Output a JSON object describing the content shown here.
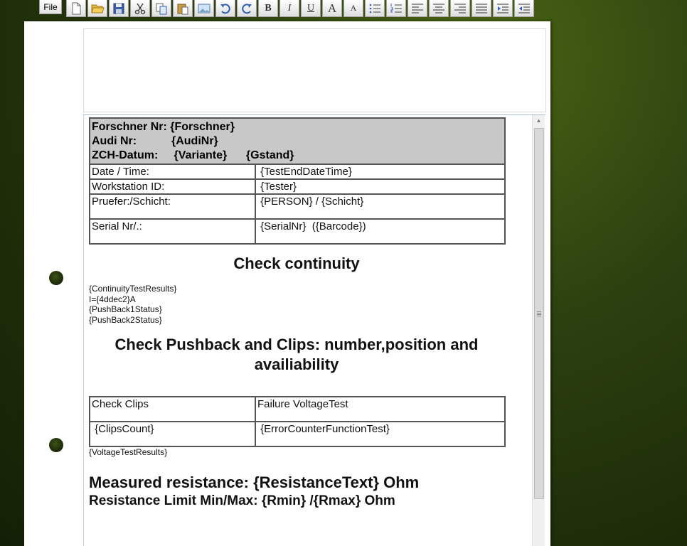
{
  "toolbar": {
    "file_label": "File",
    "bold_label": "B",
    "italic_label": "I",
    "underline_label": "U",
    "grow_font_label": "A",
    "shrink_font_label": "A"
  },
  "document": {
    "header_lines": [
      "Forschner Nr: {Forschner}",
      "Audi Nr:           {AudiNr}",
      "ZCH-Datum:     {Variante}      {Gstand}"
    ],
    "info_rows": [
      {
        "label": "Date / Time:",
        "value": " {TestEndDateTime}"
      },
      {
        "label": "Workstation ID:",
        "value": " {Tester}"
      },
      {
        "label": "Pruefer:/Schicht:",
        "value": " {PERSON} / {Schicht}"
      },
      {
        "label": "Serial Nr/.:",
        "value": " {SerialNr}  ({Barcode})"
      }
    ],
    "check_continuity_title": "Check continuity",
    "continuity_lines": [
      "{ContinuityTestResults}",
      "I={4ddec2}A",
      "{PushBack1Status}",
      "{PushBack2Status}"
    ],
    "pushback_title": "Check Pushback and Clips: number,position and availiability",
    "clips_table": {
      "header_left": "Check Clips",
      "header_right": "Failure VoltageTest",
      "value_left": " {ClipsCount}",
      "value_right": " {ErrorCounterFunctionTest}"
    },
    "voltage_results": "{VoltageTestResults}",
    "measured_resistance": "Measured resistance: {ResistanceText} Ohm",
    "resistance_limit": "Resistance Limit Min/Max: {Rmin} /{Rmax} Ohm"
  }
}
